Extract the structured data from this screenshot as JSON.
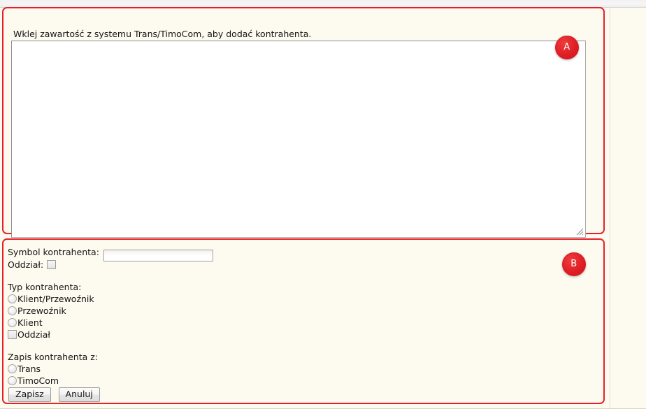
{
  "page": {
    "background_color": "#fdfaef",
    "annotation_color": "#e8202a"
  },
  "annotations": [
    {
      "id": "A",
      "label": "A",
      "target": "paste-panel"
    },
    {
      "id": "B",
      "label": "B",
      "target": "details-panel"
    }
  ],
  "paste_panel": {
    "hint": "Wklej zawartość z systemu Trans/TimoCom, aby dodać kontrahenta.",
    "textarea": {
      "value": "",
      "placeholder": "",
      "resizable": true,
      "resize_grip_icon": "resize-grip-icon"
    }
  },
  "details_panel": {
    "symbol": {
      "label": "Symbol kontrahenta:",
      "value": "",
      "placeholder": ""
    },
    "branch_field": {
      "label": "Oddział:",
      "checked": false
    },
    "contractor_type": {
      "title": "Typ kontrahenta:",
      "options": [
        {
          "label": "Klient/Przewoźnik",
          "control": "radio",
          "selected": false
        },
        {
          "label": "Przewoźnik",
          "control": "radio",
          "selected": false
        },
        {
          "label": "Klient",
          "control": "radio",
          "selected": false
        },
        {
          "label": "Oddział",
          "control": "checkbox",
          "selected": false
        }
      ]
    },
    "save_source": {
      "title": "Zapis kontrahenta z:",
      "options": [
        {
          "label": "Trans",
          "control": "radio",
          "selected": false
        },
        {
          "label": "TimoCom",
          "control": "radio",
          "selected": false
        }
      ]
    },
    "buttons": {
      "save": "Zapisz",
      "cancel": "Anuluj"
    }
  }
}
